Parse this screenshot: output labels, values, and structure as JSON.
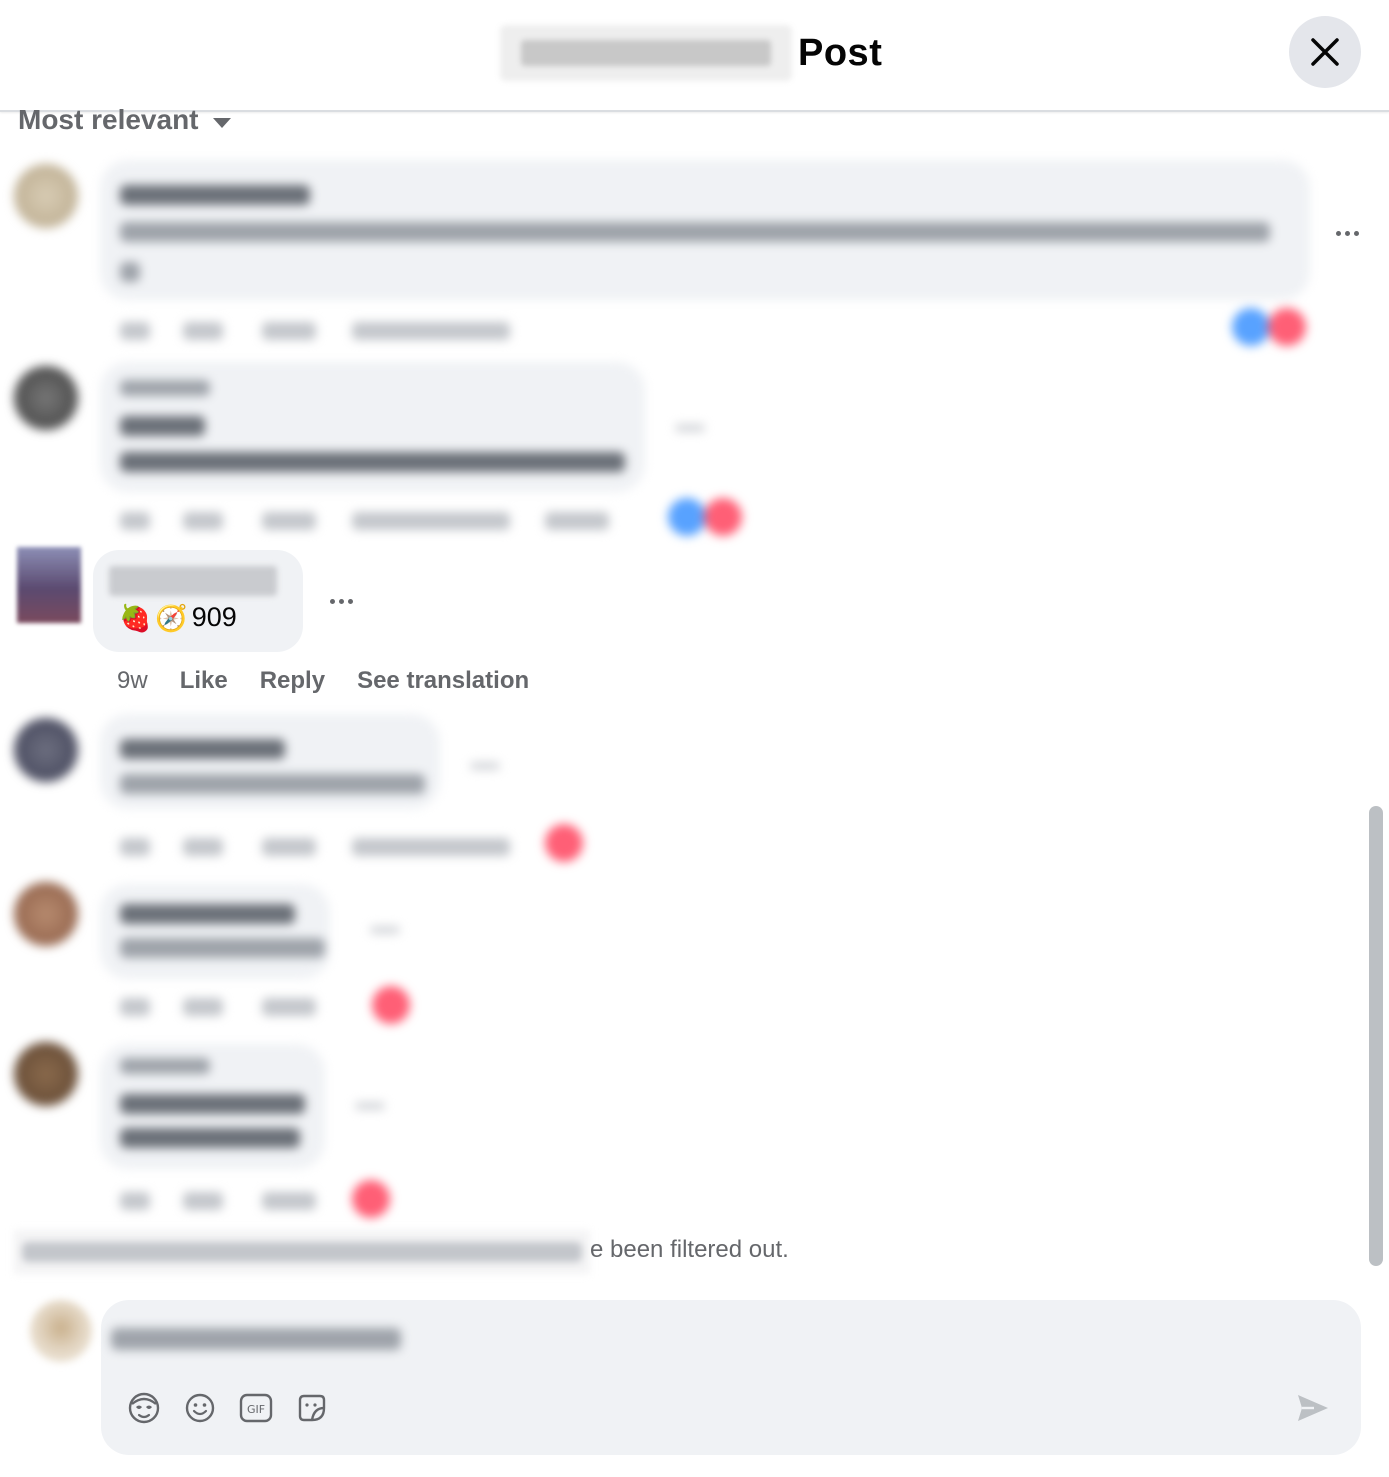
{
  "header": {
    "title": "Post",
    "close_icon": "close-icon"
  },
  "sort": {
    "label": "Most relevant",
    "icon": "caret-down-icon"
  },
  "focus_comment": {
    "text": "909",
    "emojis": [
      "🍓",
      "🧭"
    ],
    "time": "9w",
    "like_label": "Like",
    "reply_label": "Reply",
    "translate_label": "See translation"
  },
  "filtered_notice": "e been filtered out.",
  "composer": {
    "tools": [
      "avatar-sticker-icon",
      "emoji-icon",
      "gif-icon",
      "sticker-icon"
    ],
    "send_icon": "send-icon"
  },
  "colors": {
    "secondary_text": "#65676b",
    "bubble_bg": "#f0f2f5",
    "close_bg": "#e4e6eb",
    "like_blue": "#58a2ff",
    "love_red": "#ff5f76"
  }
}
